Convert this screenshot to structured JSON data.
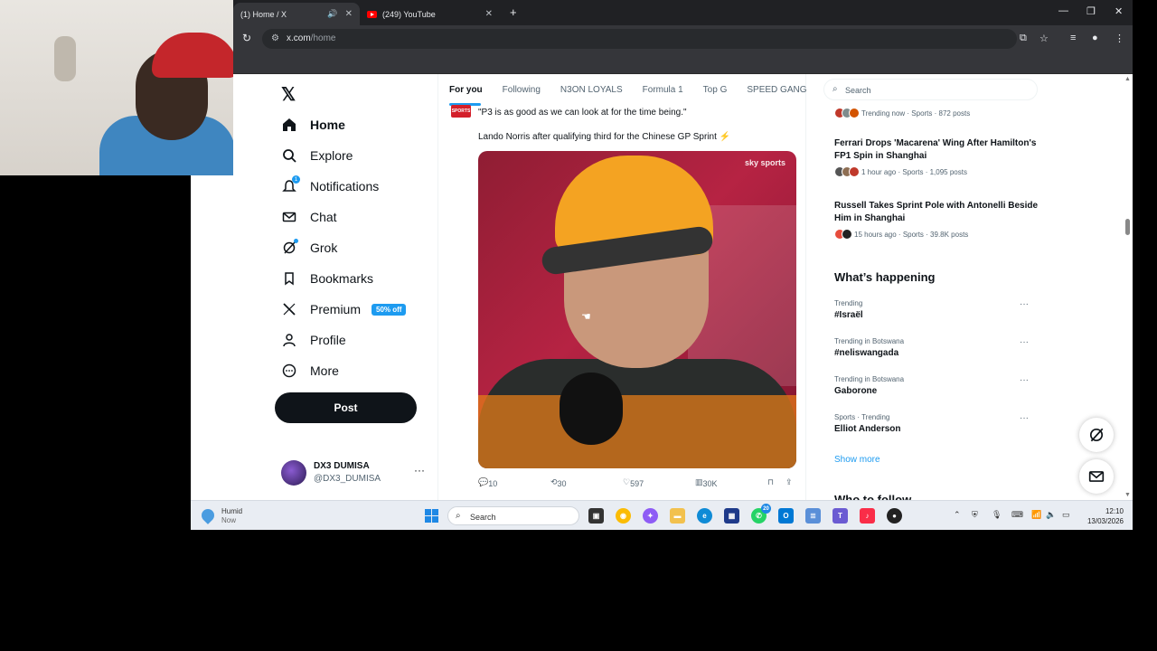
{
  "browser": {
    "tabs": [
      {
        "title": "(1) Home / X",
        "active": true
      },
      {
        "title": "(249) YouTube",
        "active": false
      }
    ],
    "address": {
      "domain": "x.com",
      "path": "/home"
    }
  },
  "nav": {
    "items": [
      {
        "label": "Home",
        "icon": "home-icon"
      },
      {
        "label": "Explore",
        "icon": "search-icon"
      },
      {
        "label": "Notifications",
        "icon": "bell-icon",
        "badge": "1"
      },
      {
        "label": "Chat",
        "icon": "mail-icon"
      },
      {
        "label": "Grok",
        "icon": "grok-icon"
      },
      {
        "label": "Bookmarks",
        "icon": "bookmark-icon"
      },
      {
        "label": "Premium",
        "icon": "x-icon",
        "badge": "50% off"
      },
      {
        "label": "Profile",
        "icon": "person-icon"
      },
      {
        "label": "More",
        "icon": "more-circle-icon"
      }
    ],
    "post_label": "Post",
    "account": {
      "name": "DX3 DUMISA",
      "handle": "@DX3_DUMISA"
    }
  },
  "feed_tabs": [
    "For you",
    "Following",
    "N3ON LOYALS",
    "Formula 1",
    "Top G",
    "SPEED GANG"
  ],
  "tweet": {
    "quote": "\"P3 is as good as we can look at for the time being.\"",
    "text": "Lando Norris after qualifying third for the Chinese GP Sprint ⚡",
    "media_watermark": "sky sports",
    "stats": {
      "replies": "10",
      "reposts": "30",
      "likes": "597",
      "views": "30K"
    }
  },
  "right": {
    "search_placeholder": "Search",
    "news": [
      {
        "headline": "",
        "meta": "Trending now · Sports · 872 posts"
      },
      {
        "headline": "Ferrari Drops 'Macarena' Wing After Hamilton's FP1 Spin in Shanghai",
        "meta": "1 hour ago · Sports · 1,095 posts"
      },
      {
        "headline": "Russell Takes Sprint Pole with Antonelli Beside Him in Shanghai",
        "meta": "15 hours ago · Sports · 39.8K posts"
      }
    ],
    "whats_happening": "What’s happening",
    "trends": [
      {
        "context": "Trending",
        "name": "#Israël"
      },
      {
        "context": "Trending in Botswana",
        "name": "#neliswangada"
      },
      {
        "context": "Trending in Botswana",
        "name": "Gaborone"
      },
      {
        "context": "Sports · Trending",
        "name": "Elliot Anderson"
      }
    ],
    "show_more": "Show more",
    "who_to_follow": "Who to follow"
  },
  "taskbar": {
    "weather_title": "Humid",
    "weather_sub": "Now",
    "search_placeholder": "Search",
    "whatsapp_badge": "20",
    "time": "12:10",
    "date": "13/03/2026"
  },
  "colors": {
    "accent": "#1d9bf0",
    "text": "#0f1419",
    "muted": "#536471"
  }
}
